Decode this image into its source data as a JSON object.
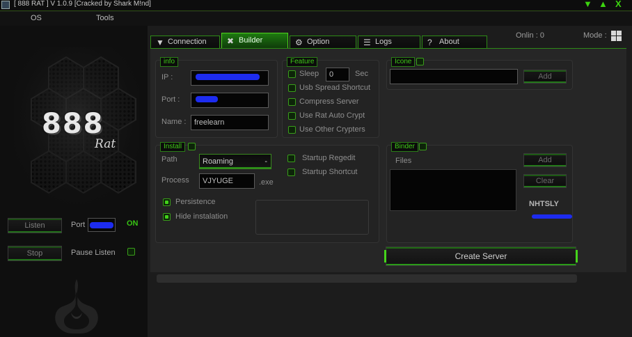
{
  "window": {
    "title": "[   888 RAT  ] V 1.0.9 [Cracked by Shark M!nd]",
    "minimize": "▼",
    "maximize": "▲",
    "close": "X"
  },
  "menu": {
    "items": [
      "OS",
      "Tools"
    ]
  },
  "sidebar": {
    "logo_text": "888",
    "logo_sub": "Rat",
    "listen_button": "Listen",
    "stop_button": "Stop",
    "port_label": "Port",
    "status": "ON",
    "pause_label": "Pause Listen"
  },
  "status": {
    "online": "Onlin : 0",
    "mode": "Mode :"
  },
  "tabs": [
    {
      "label": "Connection",
      "icon": "plug-icon"
    },
    {
      "label": "Builder",
      "icon": "tools-icon"
    },
    {
      "label": "Option",
      "icon": "gear-icon"
    },
    {
      "label": "Logs",
      "icon": "list-icon"
    },
    {
      "label": "About",
      "icon": "question-icon"
    }
  ],
  "info": {
    "title": "info",
    "ip_label": "IP :",
    "port_label": "Port :",
    "name_label": "Name :",
    "name_value": "freelearn"
  },
  "feature": {
    "title": "Feature",
    "sleep_label": "Sleep",
    "sleep_value": "0",
    "sleep_unit": "Sec",
    "options": [
      "Usb Spread Shortcut",
      "Compress Server",
      "Use Rat Auto Crypt",
      "Use Other Crypters"
    ]
  },
  "icone": {
    "title": "Icone",
    "add_button": "Add"
  },
  "install": {
    "title": "Install",
    "path_label": "Path",
    "path_value": "Roaming",
    "process_label": "Process",
    "process_value": "VJYUGE",
    "process_ext": ".exe",
    "persistence_label": "Persistence",
    "hide_label": "Hide instalation",
    "startup_regedit": "Startup Regedit",
    "startup_shortcut": "Startup Shortcut"
  },
  "binder": {
    "title": "Binder",
    "files_label": "Files",
    "add_button": "Add",
    "clear_button": "Clear",
    "tag": "NHTSLY"
  },
  "create_button": "Create Server",
  "progress": 0,
  "colors": {
    "accent": "#3fcb17",
    "redaction": "#1d2cf0"
  }
}
